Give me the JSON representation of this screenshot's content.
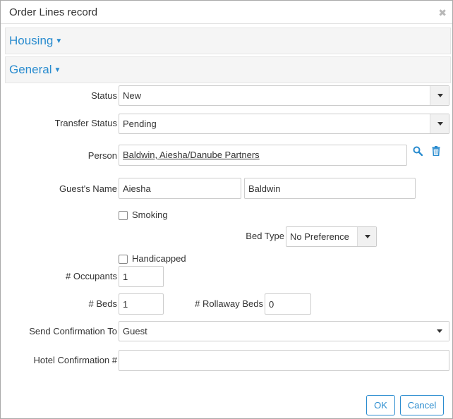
{
  "dialog": {
    "title": "Order Lines record"
  },
  "sections": {
    "housing": "Housing",
    "general": "General"
  },
  "form": {
    "status": {
      "label": "Status",
      "value": "New"
    },
    "transfer_status": {
      "label": "Transfer Status",
      "value": "Pending"
    },
    "person": {
      "label": "Person",
      "value": "Baldwin, Aiesha/Danube Partners"
    },
    "guest_name": {
      "label": "Guest's Name",
      "first": "Aiesha",
      "last": "Baldwin"
    },
    "smoking": {
      "label": "Smoking",
      "checked": false
    },
    "bed_type": {
      "label": "Bed Type",
      "value": "No Preference"
    },
    "handicapped": {
      "label": "Handicapped",
      "checked": false
    },
    "occupants": {
      "label": "# Occupants",
      "value": "1"
    },
    "beds": {
      "label": "# Beds",
      "value": "1"
    },
    "rollaway_beds": {
      "label": "# Rollaway Beds",
      "value": "0"
    },
    "send_confirmation": {
      "label": "Send Confirmation To",
      "value": "Guest"
    },
    "hotel_confirmation": {
      "label": "Hotel Confirmation #",
      "value": ""
    }
  },
  "buttons": {
    "ok": "OK",
    "cancel": "Cancel"
  },
  "colors": {
    "accent": "#2a8ccf",
    "border": "#cccccc",
    "section_bg": "#f5f5f5"
  },
  "icons": {
    "close": "close-icon",
    "search": "search-icon",
    "delete": "trash-icon",
    "dropdown": "chevron-down-icon"
  }
}
